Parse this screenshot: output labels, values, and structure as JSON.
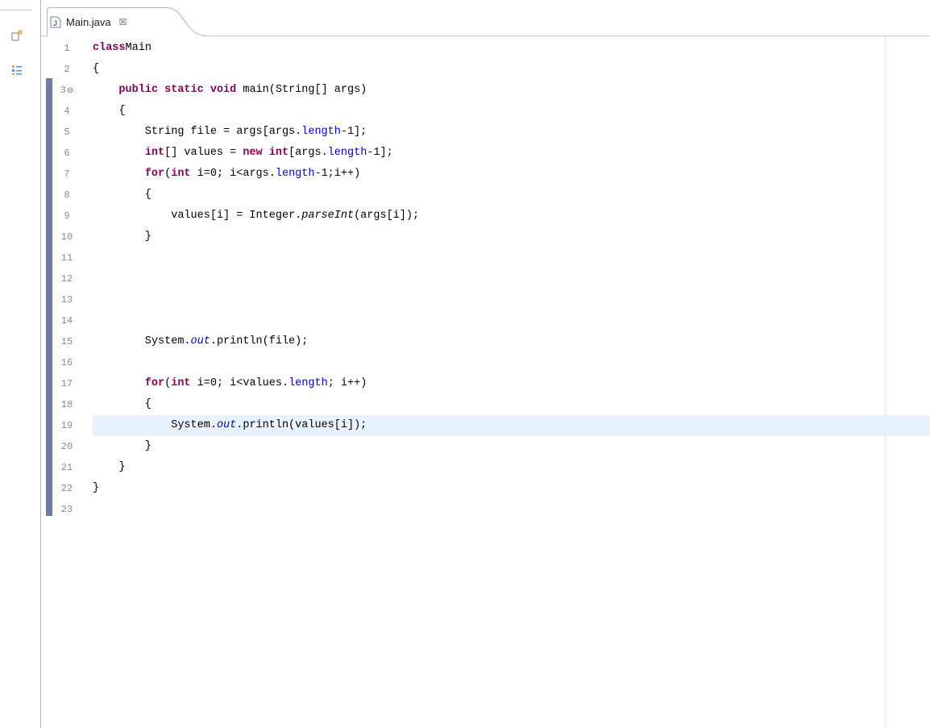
{
  "editor": {
    "tab": {
      "label": "Main.java",
      "close_glyph": "☒"
    },
    "icons": [
      "restore-icon",
      "outline-icon",
      "java-file-icon",
      "close-icon"
    ],
    "colors": {
      "keyword": "#7f0055",
      "field": "#0000c0",
      "line_number": "#8a8a8a",
      "current_line": "#e8f2fe",
      "change_bar": "#6f7da3"
    },
    "current_line": 19,
    "lines": [
      {
        "n": "1",
        "segs": [
          [
            "kw",
            "class"
          ],
          [
            "",
            "Main"
          ]
        ]
      },
      {
        "n": "2",
        "segs": [
          [
            "",
            "{"
          ]
        ]
      },
      {
        "n": "3",
        "fold": "⊖",
        "segs": [
          [
            "",
            "    "
          ],
          [
            "kw",
            "public"
          ],
          [
            "",
            " "
          ],
          [
            "kw",
            "static"
          ],
          [
            "",
            " "
          ],
          [
            "kw",
            "void"
          ],
          [
            "",
            " main(String[] args)"
          ]
        ]
      },
      {
        "n": "4",
        "segs": [
          [
            "",
            "    {"
          ]
        ]
      },
      {
        "n": "5",
        "segs": [
          [
            "",
            "        String file = args[args."
          ],
          [
            "fld",
            "length"
          ],
          [
            "",
            "-1];"
          ]
        ]
      },
      {
        "n": "6",
        "segs": [
          [
            "",
            "        "
          ],
          [
            "kw",
            "int"
          ],
          [
            "",
            "[] values = "
          ],
          [
            "kw",
            "new"
          ],
          [
            "",
            " "
          ],
          [
            "kw",
            "int"
          ],
          [
            "",
            "[args."
          ],
          [
            "fld",
            "length"
          ],
          [
            "",
            "-1];"
          ]
        ]
      },
      {
        "n": "7",
        "segs": [
          [
            "",
            "        "
          ],
          [
            "kw",
            "for"
          ],
          [
            "",
            "("
          ],
          [
            "kw",
            "int"
          ],
          [
            "",
            " i=0; i<args."
          ],
          [
            "fld",
            "length"
          ],
          [
            "",
            "-1;i++)"
          ]
        ]
      },
      {
        "n": "8",
        "segs": [
          [
            "",
            "        {"
          ]
        ]
      },
      {
        "n": "9",
        "segs": [
          [
            "",
            "            values[i] = Integer."
          ],
          [
            "it",
            "parseInt"
          ],
          [
            "",
            "(args[i]);"
          ]
        ]
      },
      {
        "n": "10",
        "segs": [
          [
            "",
            "        }"
          ]
        ]
      },
      {
        "n": "11",
        "segs": []
      },
      {
        "n": "12",
        "segs": []
      },
      {
        "n": "13",
        "segs": []
      },
      {
        "n": "14",
        "segs": []
      },
      {
        "n": "15",
        "segs": [
          [
            "",
            "        System."
          ],
          [
            "fld it",
            "out"
          ],
          [
            "",
            ".println(file);"
          ]
        ]
      },
      {
        "n": "16",
        "segs": []
      },
      {
        "n": "17",
        "segs": [
          [
            "",
            "        "
          ],
          [
            "kw",
            "for"
          ],
          [
            "",
            "("
          ],
          [
            "kw",
            "int"
          ],
          [
            "",
            " i=0; i<values."
          ],
          [
            "fld",
            "length"
          ],
          [
            "",
            "; i++)"
          ]
        ]
      },
      {
        "n": "18",
        "segs": [
          [
            "",
            "        {"
          ]
        ]
      },
      {
        "n": "19",
        "segs": [
          [
            "",
            "            System."
          ],
          [
            "fld it",
            "out"
          ],
          [
            "",
            ".println(values[i]);"
          ]
        ]
      },
      {
        "n": "20",
        "segs": [
          [
            "",
            "        }"
          ]
        ]
      },
      {
        "n": "21",
        "segs": [
          [
            "",
            "    }"
          ]
        ]
      },
      {
        "n": "22",
        "segs": [
          [
            "",
            "}"
          ]
        ]
      },
      {
        "n": "23",
        "segs": []
      }
    ]
  }
}
